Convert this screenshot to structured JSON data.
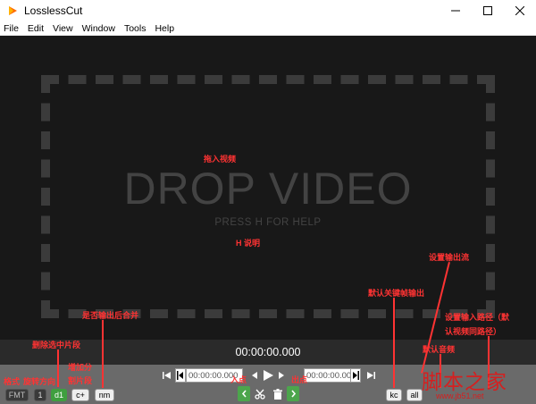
{
  "window": {
    "title": "LosslessCut"
  },
  "menu": [
    "File",
    "Edit",
    "View",
    "Window",
    "Tools",
    "Help"
  ],
  "drop": {
    "title": "DROP VIDEO",
    "help": "PRESS H FOR HELP"
  },
  "player": {
    "timecode": "00:00:00.000",
    "cut_start": "00:00:00.000",
    "cut_end": "00:00:00.000"
  },
  "toolbar": {
    "fmt": "FMT",
    "one": "1",
    "d1": "d1",
    "cplus": "c+",
    "nm": "nm",
    "kc": "kc",
    "all": "all"
  },
  "annotations": {
    "drag_video": "拖入视频",
    "h_help": "H 说明",
    "merge_after_export": "是否输出后合并",
    "delete_selected_segment": "删除选中片段",
    "format": "格式",
    "rotate": "旋转方向",
    "add_segment": "增加分",
    "add_segment_2": "割片段",
    "entry": "入点",
    "exit": "出点",
    "keyframe_export": "默认关键帧输出",
    "set_output_stream": "设置输出流",
    "audio_track": "默认音频",
    "output_path": "设置输入路径（默",
    "output_path_2": "认视频同路径）"
  },
  "watermark": {
    "brand": "脚本之家",
    "url": "www.jb51.net"
  }
}
